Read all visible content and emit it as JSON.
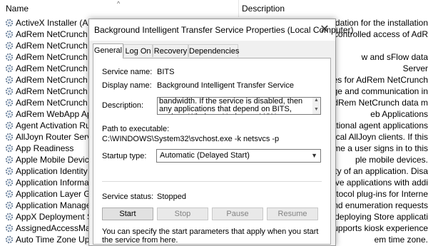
{
  "list": {
    "col_name": "Name",
    "col_desc": "Description",
    "rows": [
      {
        "name": "ActiveX Installer (AxInstSV)",
        "desc": "Provides User Account Control validation for the installation"
      },
      {
        "name": "AdRem NetCrunch Adv",
        "desc": "e and controlled access of AdR"
      },
      {
        "name": "AdRem NetCrunch Dat",
        "desc": ""
      },
      {
        "name": "AdRem NetCrunch Flo",
        "desc": "w and sFlow data"
      },
      {
        "name": "AdRem NetCrunch Gu",
        "desc": "Server"
      },
      {
        "name": "AdRem NetCrunch Me",
        "desc": "es for AdRem NetCrunch"
      },
      {
        "name": "AdRem NetCrunch Ser",
        "desc": "storage and communication in"
      },
      {
        "name": "AdRem NetCrunch Tas",
        "desc": "d AdRem NetCrunch data m"
      },
      {
        "name": "AdRem WebApp Applic",
        "desc": "eb Applications"
      },
      {
        "name": "Agent Activation Runti",
        "desc": "nversational agent applications"
      },
      {
        "name": "AllJoyn Router Service",
        "desc": "the local AllJoyn clients. If this"
      },
      {
        "name": "App Readiness",
        "desc": "first time a user signs in to this"
      },
      {
        "name": "Apple Mobile Device Se",
        "desc": "ple mobile devices."
      },
      {
        "name": "Application Identity",
        "desc": "identity of an application. Disa"
      },
      {
        "name": "Application Informatio",
        "desc": "eractive applications with addi"
      },
      {
        "name": "Application Layer Gate",
        "desc": "party protocol plug-ins for Interne"
      },
      {
        "name": "Application Manageme",
        "desc": "oval, and enumeration requests"
      },
      {
        "name": "AppX Deployment Serv",
        "desc": "port for deploying Store applicati"
      },
      {
        "name": "AssignedAccessManag",
        "desc": "ervice supports kiosk experience"
      },
      {
        "name": "Auto Time Zone Updat",
        "desc": "em time zone."
      }
    ]
  },
  "dialog": {
    "title": "Background Intelligent Transfer Service Properties (Local Computer)",
    "close_glyph": "✕",
    "tabs": [
      "General",
      "Log On",
      "Recovery",
      "Dependencies"
    ],
    "service_name_label": "Service name:",
    "service_name": "BITS",
    "display_name_label": "Display name:",
    "display_name": "Background Intelligent Transfer Service",
    "description_label": "Description:",
    "description": "bandwidth. If the service is disabled, then any applications that depend on BITS, such as Windows Update or MSN Explorer, will be unable to",
    "path_label": "Path to executable:",
    "path": "C:\\WINDOWS\\System32\\svchost.exe -k netsvcs -p",
    "startup_label": "Startup type:",
    "startup_value": "Automatic (Delayed Start)",
    "status_label": "Service status:",
    "status": "Stopped",
    "buttons": {
      "start": "Start",
      "stop": "Stop",
      "pause": "Pause",
      "resume": "Resume"
    },
    "note": "You can specify the start parameters that apply when you start the service from here."
  },
  "colors": {
    "accent": "#0078d7",
    "gear": "#6a7f99"
  }
}
